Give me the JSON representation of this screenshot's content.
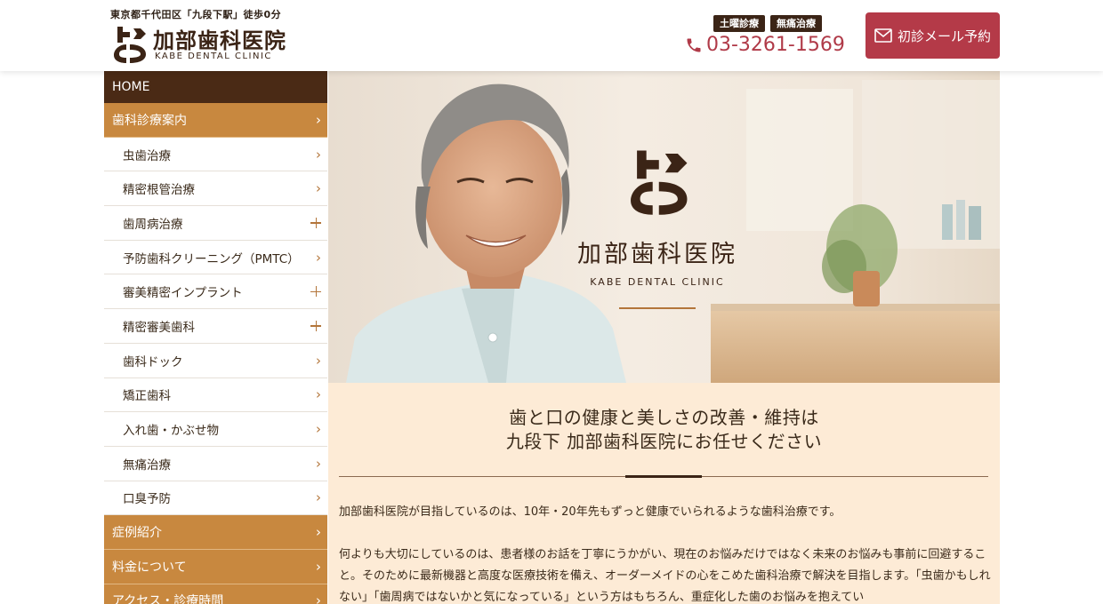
{
  "header": {
    "tagline": "東京都千代田区「九段下駅」徒歩0分",
    "clinic_name": "加部歯科医院",
    "clinic_name_en": "KABE DENTAL CLINIC",
    "badges": [
      "土曜診療",
      "無痛治療"
    ],
    "phone": "03-3261-1569",
    "mail_button_label": "初診メール予約"
  },
  "sidebar": {
    "home_label": "HOME",
    "section_label": "歯科診療案内",
    "sub_items": [
      {
        "label": "虫歯治療",
        "marker": "chevron"
      },
      {
        "label": "精密根管治療",
        "marker": "chevron"
      },
      {
        "label": "歯周病治療",
        "marker": "plus"
      },
      {
        "label": "予防歯科クリーニング（PMTC）",
        "marker": "chevron"
      },
      {
        "label": "審美精密インプラント",
        "marker": "plus"
      },
      {
        "label": "精密審美歯科",
        "marker": "plus"
      },
      {
        "label": "歯科ドック",
        "marker": "chevron"
      },
      {
        "label": "矯正歯科",
        "marker": "chevron"
      },
      {
        "label": "入れ歯・かぶせ物",
        "marker": "chevron"
      },
      {
        "label": "無痛治療",
        "marker": "chevron"
      },
      {
        "label": "口臭予防",
        "marker": "chevron"
      }
    ],
    "main_items": [
      {
        "label": "症例紹介"
      },
      {
        "label": "料金について"
      },
      {
        "label": "アクセス・診療時間"
      }
    ]
  },
  "hero": {
    "clinic_name": "加部歯科医院",
    "clinic_name_en": "KABE DENTAL CLINIC"
  },
  "intro": {
    "heading_line1": "歯と口の健康と美しさの改善・維持は",
    "heading_line2": "九段下 加部歯科医院にお任せください",
    "paragraph1": "加部歯科医院が目指しているのは、10年・20年先もずっと健康でいられるような歯科治療です。",
    "paragraph2": "何よりも大切にしているのは、患者様のお話を丁寧にうかがい、現在のお悩みだけではなく未来のお悩みも事前に回避すること。そのために最新機器と高度な医療技術を備え、オーダーメイドの心をこめた歯科治療で解決を目指します。「虫歯かもしれない」「歯周病ではないかと気になっている」という方はもちろん、重症化した歯のお悩みを抱えてい"
  },
  "colors": {
    "brand_brown": "#3b2416",
    "nav_gold": "#c8883f",
    "accent_red": "#b43a48",
    "intro_bg": "#fdebd6"
  }
}
